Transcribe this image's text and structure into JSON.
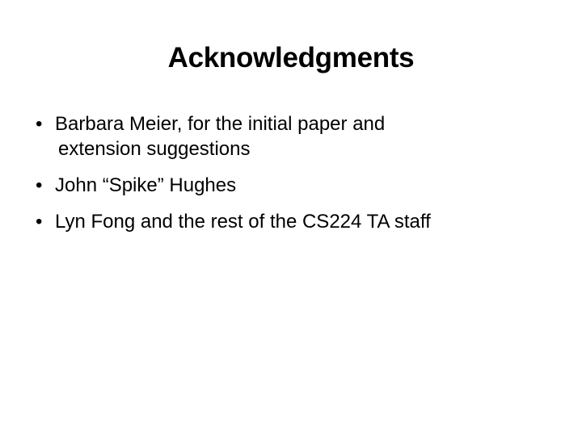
{
  "slide": {
    "title": "Acknowledgments",
    "bullet_symbol": "•",
    "items": [
      {
        "lines": [
          "Barbara Meier, for the initial paper and",
          "extension suggestions"
        ]
      },
      {
        "lines": [
          "John “Spike” Hughes"
        ]
      },
      {
        "lines": [
          "Lyn Fong and the rest of the CS224 TA staff"
        ]
      }
    ]
  },
  "colors": {
    "background": "#ffffff",
    "text": "#000000"
  }
}
